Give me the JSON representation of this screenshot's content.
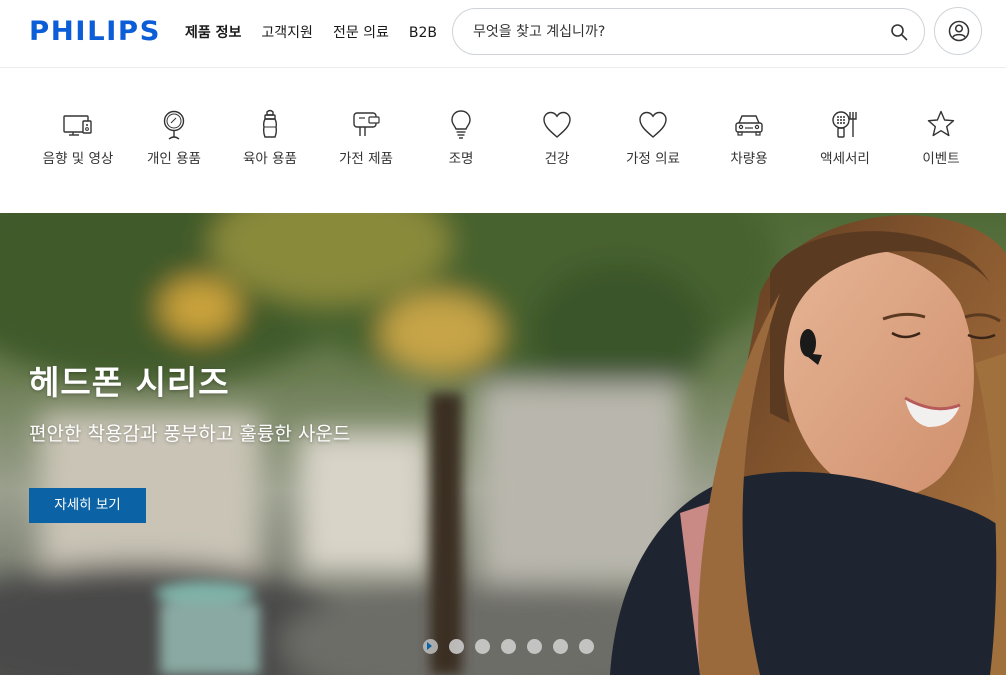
{
  "brand": {
    "name": "PHILIPS",
    "color": "#0b5ed7"
  },
  "nav": [
    {
      "label": "제품 정보",
      "active": true
    },
    {
      "label": "고객지원"
    },
    {
      "label": "전문 의료"
    },
    {
      "label": "B2B"
    }
  ],
  "search": {
    "placeholder": "무엇을 찾고 계십니까?",
    "icon": "search-icon"
  },
  "account": {
    "icon": "user-icon"
  },
  "categories": [
    {
      "label": "음향 및 영상",
      "icon": "tv-icon"
    },
    {
      "label": "개인 용품",
      "icon": "mirror-icon"
    },
    {
      "label": "육아 용품",
      "icon": "baby-bottle-icon"
    },
    {
      "label": "가전 제품",
      "icon": "mixer-icon"
    },
    {
      "label": "조명",
      "icon": "lightbulb-icon"
    },
    {
      "label": "건강",
      "icon": "heart-icon"
    },
    {
      "label": "가정 의료",
      "icon": "heart-icon"
    },
    {
      "label": "차량용",
      "icon": "car-icon"
    },
    {
      "label": "액세서리",
      "icon": "accessory-icon"
    },
    {
      "label": "이벤트",
      "icon": "star-icon"
    }
  ],
  "hero": {
    "title": "헤드폰 시리즈",
    "subtitle": "편안한 착용감과 풍부하고 훌륭한 사운드",
    "cta": "자세히 보기",
    "cta_color": "#0b63a6",
    "slides": 7,
    "active_slide": 1
  }
}
